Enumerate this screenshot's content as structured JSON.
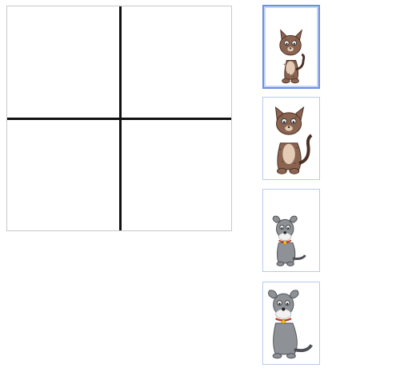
{
  "grid": {
    "rows": 2,
    "cols": 2,
    "cells": [
      "",
      "",
      "",
      ""
    ]
  },
  "cards": [
    {
      "label": "cat",
      "icon": "cat-icon",
      "selected": true
    },
    {
      "label": "cat",
      "icon": "cat-icon",
      "selected": false
    },
    {
      "label": "dog",
      "icon": "dog-icon",
      "selected": false
    },
    {
      "label": "dog",
      "icon": "dog-icon",
      "selected": false
    }
  ],
  "colors": {
    "grid_lines": "#111111",
    "card_border": "#b9c9ea",
    "selected_border": "#6d8fe0",
    "cat_fur": "#8a6450",
    "dog_fur": "#8e9196"
  }
}
